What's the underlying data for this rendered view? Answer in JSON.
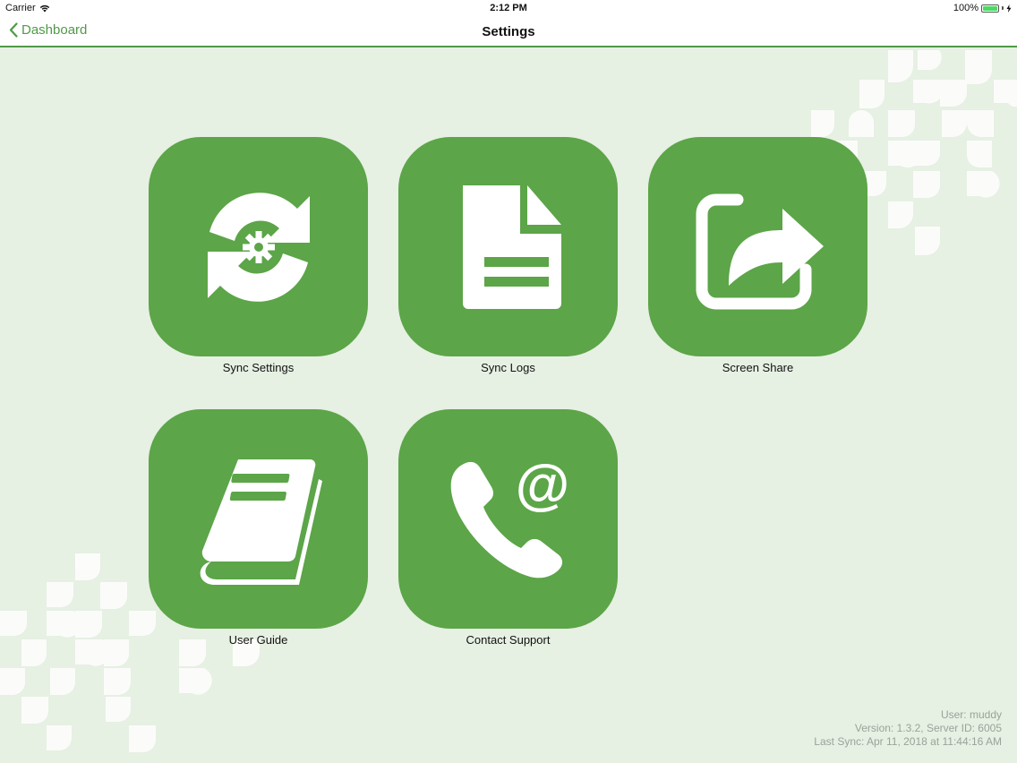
{
  "status_bar": {
    "carrier": "Carrier",
    "time": "2:12 PM",
    "battery": "100%",
    "battery_level": 1.0
  },
  "nav": {
    "back_label": "Dashboard",
    "title": "Settings"
  },
  "tiles": [
    {
      "label": "Sync Settings",
      "icon": "sync-gear-icon"
    },
    {
      "label": "Sync Logs",
      "icon": "document-icon"
    },
    {
      "label": "Screen Share",
      "icon": "share-icon"
    },
    {
      "label": "User Guide",
      "icon": "book-icon"
    },
    {
      "label": "Contact Support",
      "icon": "phone-at-icon"
    }
  ],
  "footer": {
    "user": "User: muddy",
    "version": "Version: 1.3.2, Server ID: 6005",
    "last_sync": "Last Sync: Apr 11, 2018 at 11:44:16 AM"
  },
  "colors": {
    "accent": "#4f9a47",
    "tile": "#5ca548",
    "background": "#e6f0e3"
  }
}
